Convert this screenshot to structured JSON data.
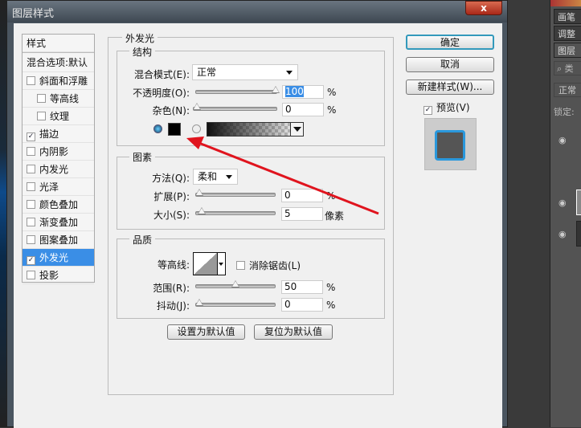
{
  "dialog": {
    "title": "图层样式",
    "close_icon": "close-icon"
  },
  "styles_list": {
    "header": "样式",
    "blend_options": "混合选项:默认",
    "items": [
      {
        "label": "斜面和浮雕",
        "checked": false,
        "indent": false
      },
      {
        "label": "等高线",
        "checked": false,
        "indent": true
      },
      {
        "label": "纹理",
        "checked": false,
        "indent": true
      },
      {
        "label": "描边",
        "checked": true,
        "indent": false
      },
      {
        "label": "内阴影",
        "checked": false,
        "indent": false
      },
      {
        "label": "内发光",
        "checked": false,
        "indent": false
      },
      {
        "label": "光泽",
        "checked": false,
        "indent": false
      },
      {
        "label": "颜色叠加",
        "checked": false,
        "indent": false
      },
      {
        "label": "渐变叠加",
        "checked": false,
        "indent": false
      },
      {
        "label": "图案叠加",
        "checked": false,
        "indent": false
      },
      {
        "label": "外发光",
        "checked": true,
        "indent": false,
        "selected": true
      },
      {
        "label": "投影",
        "checked": false,
        "indent": false
      }
    ]
  },
  "outer_glow": {
    "title": "外发光",
    "structure": {
      "title": "结构",
      "blend_mode_label": "混合模式(E):",
      "blend_mode": "正常",
      "opacity_label": "不透明度(O):",
      "opacity": "100",
      "opacity_unit": "%",
      "noise_label": "杂色(N):",
      "noise": "0",
      "noise_unit": "%",
      "color": "#000000"
    },
    "elements": {
      "title": "图素",
      "technique_label": "方法(Q):",
      "technique": "柔和",
      "spread_label": "扩展(P):",
      "spread": "0",
      "spread_unit": "%",
      "size_label": "大小(S):",
      "size": "5",
      "size_unit": "像素"
    },
    "quality": {
      "title": "品质",
      "contour_label": "等高线:",
      "anti_alias_label": "消除锯齿(L)",
      "anti_alias": false,
      "range_label": "范围(R):",
      "range": "50",
      "range_unit": "%",
      "jitter_label": "抖动(J):",
      "jitter": "0",
      "jitter_unit": "%"
    },
    "make_default": "设置为默认值",
    "reset_default": "复位为默认值"
  },
  "buttons": {
    "ok": "确定",
    "cancel": "取消",
    "new_style": "新建样式(W)...",
    "preview_label": "预览(V)",
    "preview_checked": true
  },
  "ps_panel": {
    "tabs": [
      "画笔",
      "调整",
      "图层"
    ],
    "search": "类",
    "blend": "正常",
    "lock": "锁定:"
  },
  "colors": {
    "accent": "#3a8ee6",
    "arrow": "#e0141e"
  }
}
